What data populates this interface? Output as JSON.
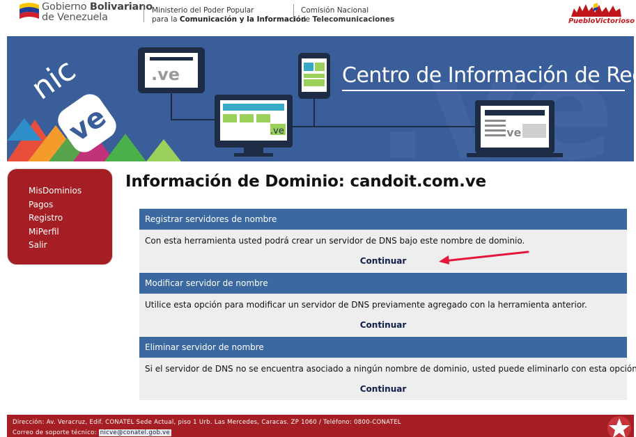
{
  "header": {
    "gov_line1_prefix": "Gobierno ",
    "gov_line1_bold": "Bolivariano",
    "gov_line2": "de Venezuela",
    "ministry_line1": "Ministerio del Poder Popular",
    "ministry_line2_prefix": "para la ",
    "ministry_line2_bold": "Comunicación y la Información",
    "commission_line1": "Comisión Nacional",
    "commission_line2_prefix": "de ",
    "commission_line2_bold": "Telecomunicaciones",
    "right_logo_text": "PuebloVictorioso"
  },
  "banner": {
    "title": "Centro de Información de Red",
    "logo_top": "nic",
    "logo_bottom": "ve",
    "screen_label": ".ve"
  },
  "sidebar": {
    "items": [
      {
        "label": "MisDominios"
      },
      {
        "label": "Pagos"
      },
      {
        "label": "Registro"
      },
      {
        "label": "MiPerfil"
      },
      {
        "label": "Salir"
      }
    ]
  },
  "main": {
    "title": "Información de Dominio: candoit.com.ve",
    "sections": [
      {
        "heading": "Registrar servidores de nombre",
        "description": "Con esta herramienta usted podrá crear un servidor de DNS bajo este nombre de dominio.",
        "link": "Continuar"
      },
      {
        "heading": "Modificar servidor de nombre",
        "description": "Utilice esta opción para modificar un servidor de DNS previamente agregado con la herramienta anterior.",
        "link": "Continuar"
      },
      {
        "heading": "Eliminar servidor de nombre",
        "description": "Si el servidor de DNS no se encuentra asociado a ningún nombre de dominio, usted puede eliminarlo con esta opción.",
        "link": "Continuar"
      }
    ]
  },
  "footer": {
    "address": "Dirección: Av. Veracruz, Edif. CONATEL Sede Actual, piso 1 Urb. Las Mercedes, Caracas. ZP 1060 / Teléfono: 0800-CONATEL",
    "support_label": "Correo de soporte técnico:",
    "support_email": "nicve@conatel.gob.ve"
  },
  "colors": {
    "brand_red": "#a51e23",
    "section_blue": "#3a689f",
    "banner_blue": "#3a5e9a",
    "link_navy": "#0f1f4b",
    "annotation_arrow": "#e5173f"
  },
  "icons": [
    "venezuela-flag-icon",
    "pueblo-victorioso-logo",
    "nic-ve-logo",
    "star-icon",
    "annotation-arrow"
  ]
}
